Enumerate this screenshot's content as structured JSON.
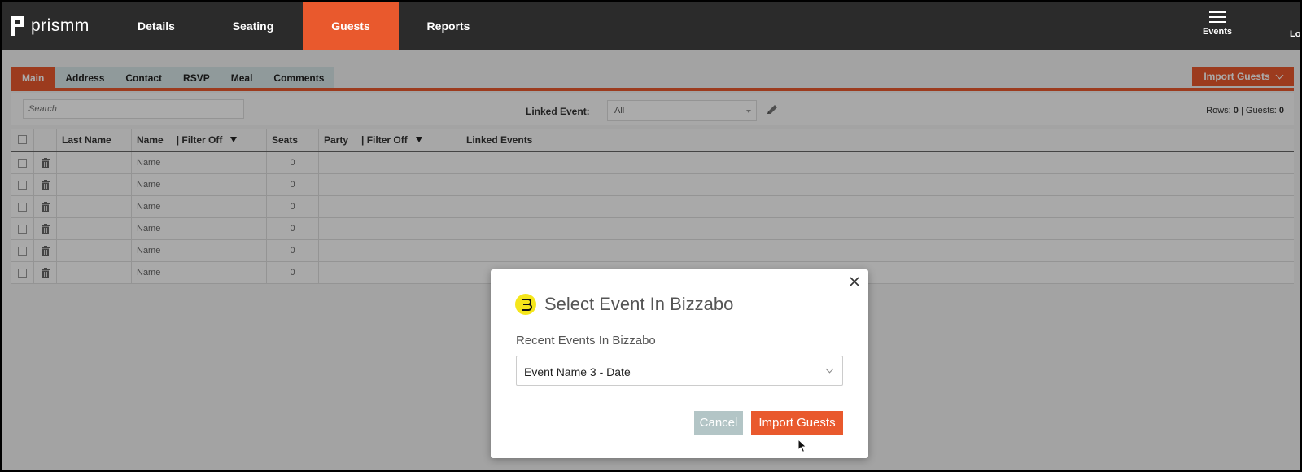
{
  "app": {
    "logo_text": "prismm"
  },
  "nav": {
    "items": [
      {
        "label": "Details"
      },
      {
        "label": "Seating"
      },
      {
        "label": "Guests",
        "active": true
      },
      {
        "label": "Reports"
      }
    ],
    "events_label": "Events",
    "logout_label": "Lo"
  },
  "subtabs": {
    "items": [
      {
        "label": "Main",
        "active": true
      },
      {
        "label": "Address"
      },
      {
        "label": "Contact"
      },
      {
        "label": "RSVP"
      },
      {
        "label": "Meal"
      },
      {
        "label": "Comments"
      }
    ],
    "import_button": "Import Guests"
  },
  "filters": {
    "search_placeholder": "Search",
    "linked_event_label": "Linked Event:",
    "linked_event_value": "All",
    "rows_label": "Rows:",
    "rows_count": "0",
    "guests_label": "Guests:",
    "guests_count": "0"
  },
  "table": {
    "headers": {
      "last_name": "Last Name",
      "name": "Name",
      "name_filter": "| Filter Off",
      "seats": "Seats",
      "party": "Party",
      "party_filter": "| Filter Off",
      "linked_events": "Linked Events"
    },
    "rows": [
      {
        "last_name": "",
        "name": "Name",
        "seats": "0",
        "party": "",
        "linked": ""
      },
      {
        "last_name": "",
        "name": "Name",
        "seats": "0",
        "party": "",
        "linked": ""
      },
      {
        "last_name": "",
        "name": "Name",
        "seats": "0",
        "party": "",
        "linked": ""
      },
      {
        "last_name": "",
        "name": "Name",
        "seats": "0",
        "party": "",
        "linked": ""
      },
      {
        "last_name": "",
        "name": "Name",
        "seats": "0",
        "party": "",
        "linked": ""
      },
      {
        "last_name": "",
        "name": "Name",
        "seats": "0",
        "party": "",
        "linked": ""
      }
    ]
  },
  "modal": {
    "title": "Select Event In Bizzabo",
    "label": "Recent Events In Bizzabo",
    "selected_event": "Event Name 3 - Date",
    "cancel": "Cancel",
    "import": "Import Guests"
  },
  "colors": {
    "accent": "#e9592d",
    "topbar": "#2b2b2b",
    "subtab_bg": "#d7e6e7",
    "cancel_bg": "#b3c5c6",
    "bizzabo_yellow": "#f5e61b"
  }
}
